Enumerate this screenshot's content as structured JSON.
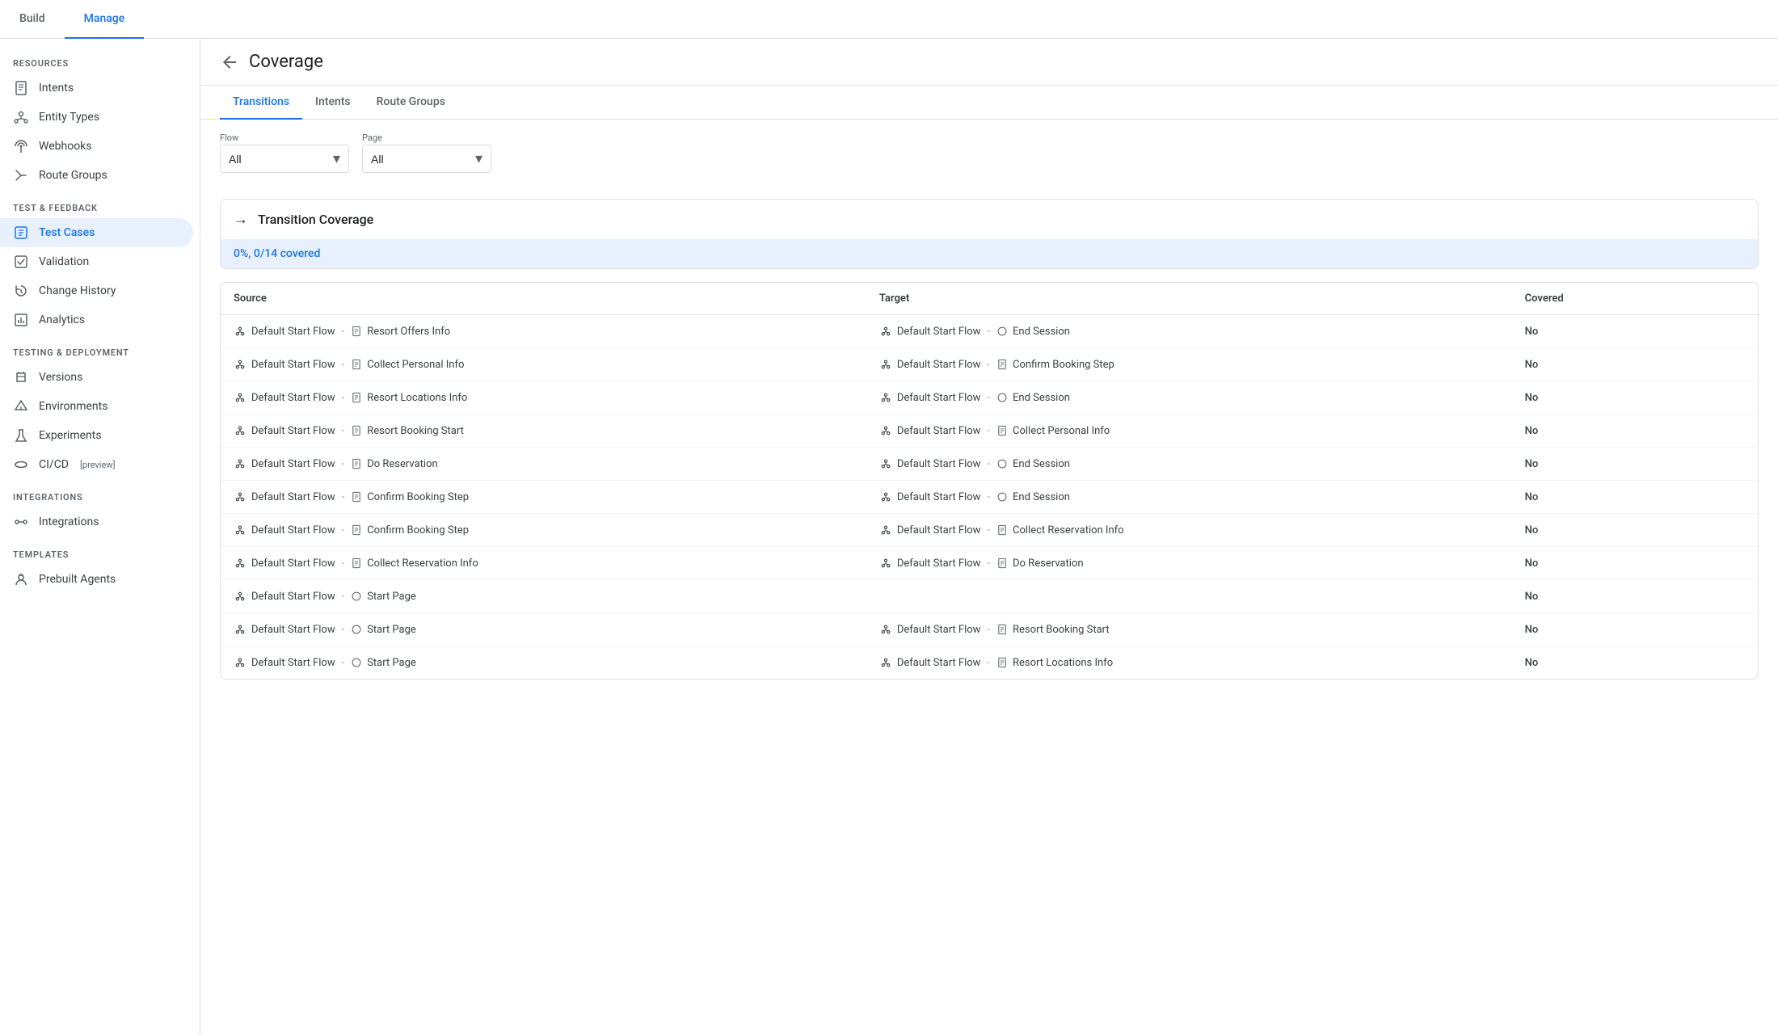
{
  "topNav": {
    "tabs": [
      {
        "id": "build",
        "label": "Build",
        "active": false
      },
      {
        "id": "manage",
        "label": "Manage",
        "active": true
      }
    ]
  },
  "sidebar": {
    "sections": [
      {
        "label": "Resources",
        "items": [
          {
            "id": "intents",
            "label": "Intents",
            "icon": "doc-icon",
            "active": false
          },
          {
            "id": "entity-types",
            "label": "Entity Types",
            "icon": "entity-icon",
            "active": false
          },
          {
            "id": "webhooks",
            "label": "Webhooks",
            "icon": "webhook-icon",
            "active": false
          },
          {
            "id": "route-groups",
            "label": "Route Groups",
            "icon": "route-icon",
            "active": false
          }
        ]
      },
      {
        "label": "Test & Feedback",
        "items": [
          {
            "id": "test-cases",
            "label": "Test Cases",
            "icon": "test-icon",
            "active": true
          },
          {
            "id": "validation",
            "label": "Validation",
            "icon": "validation-icon",
            "active": false
          },
          {
            "id": "change-history",
            "label": "Change History",
            "icon": "history-icon",
            "active": false
          },
          {
            "id": "analytics",
            "label": "Analytics",
            "icon": "analytics-icon",
            "active": false
          }
        ]
      },
      {
        "label": "Testing & Deployment",
        "items": [
          {
            "id": "versions",
            "label": "Versions",
            "icon": "versions-icon",
            "active": false
          },
          {
            "id": "environments",
            "label": "Environments",
            "icon": "env-icon",
            "active": false
          },
          {
            "id": "experiments",
            "label": "Experiments",
            "icon": "exp-icon",
            "active": false
          },
          {
            "id": "cicd",
            "label": "CI/CD",
            "icon": "cicd-icon",
            "active": false,
            "badge": "[preview]"
          }
        ]
      },
      {
        "label": "Integrations",
        "items": [
          {
            "id": "integrations",
            "label": "Integrations",
            "icon": "integrations-icon",
            "active": false
          }
        ]
      },
      {
        "label": "Templates",
        "items": [
          {
            "id": "prebuilt-agents",
            "label": "Prebuilt Agents",
            "icon": "prebuilt-icon",
            "active": false
          }
        ]
      }
    ]
  },
  "header": {
    "title": "Coverage",
    "backLabel": "Back"
  },
  "contentTabs": [
    {
      "id": "transitions",
      "label": "Transitions",
      "active": true
    },
    {
      "id": "intents",
      "label": "Intents",
      "active": false
    },
    {
      "id": "route-groups",
      "label": "Route Groups",
      "active": false
    }
  ],
  "filters": {
    "flow": {
      "label": "Flow",
      "value": "All",
      "options": [
        "All"
      ]
    },
    "page": {
      "label": "Page",
      "value": "All",
      "options": [
        "All"
      ]
    }
  },
  "coverageSection": {
    "title": "Transition Coverage",
    "stats": "0%, 0/14 covered"
  },
  "table": {
    "headers": [
      "Source",
      "Target",
      "Covered"
    ],
    "rows": [
      {
        "source": {
          "flow": "Default Start Flow",
          "pageType": "doc",
          "page": "Resort Offers Info"
        },
        "target": {
          "flow": "Default Start Flow",
          "pageType": "circle",
          "page": "End Session"
        },
        "covered": "No"
      },
      {
        "source": {
          "flow": "Default Start Flow",
          "pageType": "doc",
          "page": "Collect Personal Info"
        },
        "target": {
          "flow": "Default Start Flow",
          "pageType": "doc",
          "page": "Confirm Booking Step"
        },
        "covered": "No"
      },
      {
        "source": {
          "flow": "Default Start Flow",
          "pageType": "doc",
          "page": "Resort Locations Info"
        },
        "target": {
          "flow": "Default Start Flow",
          "pageType": "circle",
          "page": "End Session"
        },
        "covered": "No"
      },
      {
        "source": {
          "flow": "Default Start Flow",
          "pageType": "doc",
          "page": "Resort Booking Start"
        },
        "target": {
          "flow": "Default Start Flow",
          "pageType": "doc",
          "page": "Collect Personal Info"
        },
        "covered": "No"
      },
      {
        "source": {
          "flow": "Default Start Flow",
          "pageType": "doc",
          "page": "Do Reservation"
        },
        "target": {
          "flow": "Default Start Flow",
          "pageType": "circle",
          "page": "End Session"
        },
        "covered": "No"
      },
      {
        "source": {
          "flow": "Default Start Flow",
          "pageType": "doc",
          "page": "Confirm Booking Step"
        },
        "target": {
          "flow": "Default Start Flow",
          "pageType": "circle",
          "page": "End Session"
        },
        "covered": "No"
      },
      {
        "source": {
          "flow": "Default Start Flow",
          "pageType": "doc",
          "page": "Confirm Booking Step"
        },
        "target": {
          "flow": "Default Start Flow",
          "pageType": "doc",
          "page": "Collect Reservation Info"
        },
        "covered": "No"
      },
      {
        "source": {
          "flow": "Default Start Flow",
          "pageType": "doc",
          "page": "Collect Reservation Info"
        },
        "target": {
          "flow": "Default Start Flow",
          "pageType": "doc",
          "page": "Do Reservation"
        },
        "covered": "No"
      },
      {
        "source": {
          "flow": "Default Start Flow",
          "pageType": "circle",
          "page": "Start Page"
        },
        "target": null,
        "covered": "No"
      },
      {
        "source": {
          "flow": "Default Start Flow",
          "pageType": "circle",
          "page": "Start Page"
        },
        "target": {
          "flow": "Default Start Flow",
          "pageType": "doc",
          "page": "Resort Booking Start"
        },
        "covered": "No"
      },
      {
        "source": {
          "flow": "Default Start Flow",
          "pageType": "circle",
          "page": "Start Page"
        },
        "target": {
          "flow": "Default Start Flow",
          "pageType": "doc",
          "page": "Resort Locations Info"
        },
        "covered": "No"
      }
    ]
  }
}
